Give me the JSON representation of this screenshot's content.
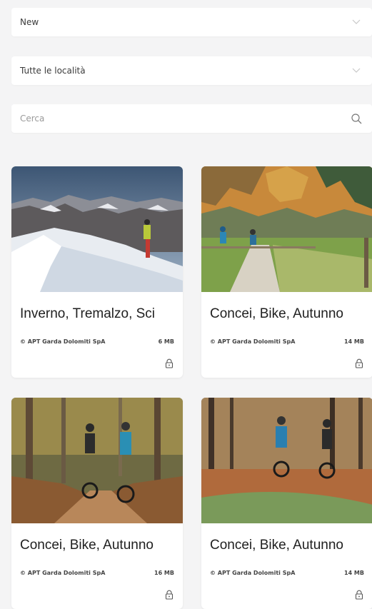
{
  "filters": {
    "sort": {
      "value": "New"
    },
    "location": {
      "value": "Tutte le località"
    },
    "search": {
      "placeholder": "Cerca"
    }
  },
  "cards": [
    {
      "title": "Inverno, Tremalzo, Sci",
      "credit": "© APT Garda Dolomiti SpA",
      "size": "6 MB",
      "image": "winter-ski-mountains"
    },
    {
      "title": "Concei, Bike, Autunno",
      "credit": "© APT Garda Dolomiti SpA",
      "size": "14 MB",
      "image": "autumn-bike-path"
    },
    {
      "title": "Concei, Bike, Autunno",
      "credit": "© APT Garda Dolomiti SpA",
      "size": "16 MB",
      "image": "forest-bike-trail"
    },
    {
      "title": "Concei, Bike, Autunno",
      "credit": "© APT Garda Dolomiti SpA",
      "size": "14 MB",
      "image": "forest-bike-leaves"
    }
  ],
  "colors": {
    "background": "#f4f4f5",
    "card": "#ffffff",
    "text": "#1f1f1f",
    "muted": "#9a9a9a"
  },
  "icons": {
    "dropdown": "chevron-down-icon",
    "search": "search-icon",
    "lock": "lock-icon"
  }
}
